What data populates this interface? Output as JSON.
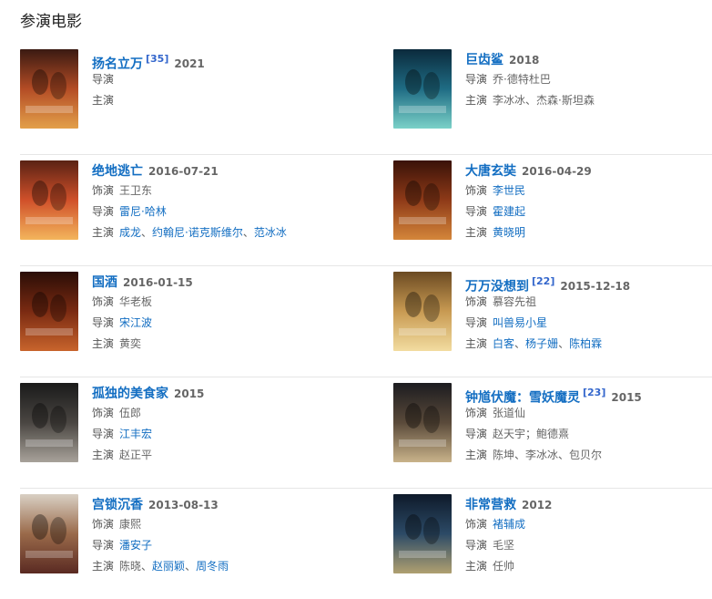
{
  "section_title": "参演电影",
  "movies": [
    {
      "title": "扬名立万",
      "ref": "[35]",
      "meta": "2021",
      "lines": [
        {
          "label": "导演",
          "parts": []
        },
        {
          "label": "主演",
          "parts": []
        }
      ],
      "poster_colors": [
        "#3a1a12",
        "#b44c25",
        "#e3a04a"
      ]
    },
    {
      "title": "巨齿鲨",
      "ref": "",
      "meta": "2018",
      "lines": [
        {
          "label": "导演",
          "parts": [
            {
              "t": "乔·德特杜巴",
              "link": false
            }
          ]
        },
        {
          "label": "主演",
          "parts": [
            {
              "t": "李冰冰、杰森·斯坦森",
              "link": false
            }
          ]
        }
      ],
      "poster_colors": [
        "#0b2a3c",
        "#1f6c84",
        "#7bd1c8"
      ]
    },
    {
      "title": "绝地逃亡",
      "ref": "",
      "meta": "2016-07-21",
      "lines": [
        {
          "label": "饰演",
          "parts": [
            {
              "t": "王卫东",
              "link": false
            }
          ]
        },
        {
          "label": "导演",
          "parts": [
            {
              "t": "雷尼·哈林",
              "link": true
            }
          ]
        },
        {
          "label": "主演",
          "parts": [
            {
              "t": "成龙",
              "link": true
            },
            {
              "t": "、",
              "link": false
            },
            {
              "t": "约翰尼·诺克斯维尔",
              "link": true
            },
            {
              "t": "、",
              "link": false
            },
            {
              "t": "范冰冰",
              "link": true
            }
          ]
        }
      ],
      "poster_colors": [
        "#5a2214",
        "#d0502a",
        "#f3b55c"
      ]
    },
    {
      "title": "大唐玄奘",
      "ref": "",
      "meta": "2016-04-29",
      "lines": [
        {
          "label": "饰演",
          "parts": [
            {
              "t": "李世民",
              "link": true
            }
          ]
        },
        {
          "label": "导演",
          "parts": [
            {
              "t": "霍建起",
              "link": true
            }
          ]
        },
        {
          "label": "主演",
          "parts": [
            {
              "t": "黄晓明",
              "link": true
            }
          ]
        }
      ],
      "poster_colors": [
        "#3a1208",
        "#8e3a18",
        "#d4863a"
      ]
    },
    {
      "title": "国酒",
      "ref": "",
      "meta": "2016-01-15",
      "lines": [
        {
          "label": "饰演",
          "parts": [
            {
              "t": "华老板",
              "link": false
            }
          ]
        },
        {
          "label": "导演",
          "parts": [
            {
              "t": "宋江波",
              "link": true
            }
          ]
        },
        {
          "label": "主演",
          "parts": [
            {
              "t": "黄奕",
              "link": false
            }
          ]
        }
      ],
      "poster_colors": [
        "#2a0d06",
        "#7a2a12",
        "#c8642c"
      ]
    },
    {
      "title": "万万没想到",
      "ref": "[22]",
      "meta": "2015-12-18",
      "lines": [
        {
          "label": "饰演",
          "parts": [
            {
              "t": "慕容先祖",
              "link": false
            }
          ]
        },
        {
          "label": "导演",
          "parts": [
            {
              "t": "叫兽易小星",
              "link": true
            }
          ]
        },
        {
          "label": "主演",
          "parts": [
            {
              "t": "白客",
              "link": true
            },
            {
              "t": "、",
              "link": false
            },
            {
              "t": "杨子姗",
              "link": true
            },
            {
              "t": "、",
              "link": false
            },
            {
              "t": "陈柏霖",
              "link": true
            }
          ]
        }
      ],
      "poster_colors": [
        "#6b4a22",
        "#c89a52",
        "#f2dca0"
      ]
    },
    {
      "title": "孤独的美食家",
      "ref": "",
      "meta": "2015",
      "lines": [
        {
          "label": "饰演",
          "parts": [
            {
              "t": "伍郎",
              "link": false
            }
          ]
        },
        {
          "label": "导演",
          "parts": [
            {
              "t": "江丰宏",
              "link": true
            }
          ]
        },
        {
          "label": "主演",
          "parts": [
            {
              "t": "赵正平",
              "link": false
            }
          ]
        }
      ],
      "poster_colors": [
        "#1a1a1a",
        "#4a4642",
        "#a8a29a"
      ]
    },
    {
      "title": "钟馗伏魔：雪妖魔灵",
      "ref": "[23]",
      "meta": "2015",
      "lines": [
        {
          "label": "饰演",
          "parts": [
            {
              "t": "张道仙",
              "link": false
            }
          ]
        },
        {
          "label": "导演",
          "parts": [
            {
              "t": "赵天宇；鲍德熹",
              "link": false
            }
          ]
        },
        {
          "label": "主演",
          "parts": [
            {
              "t": "陈坤、李冰冰、包贝尔",
              "link": false
            }
          ]
        }
      ],
      "poster_colors": [
        "#1c1c20",
        "#5a4a3a",
        "#c9b38a"
      ]
    },
    {
      "title": "宫锁沉香",
      "ref": "",
      "meta": "2013-08-13",
      "lines": [
        {
          "label": "饰演",
          "parts": [
            {
              "t": "康熙",
              "link": false
            }
          ]
        },
        {
          "label": "导演",
          "parts": [
            {
              "t": "潘安子",
              "link": true
            }
          ]
        },
        {
          "label": "主演",
          "parts": [
            {
              "t": "陈晓",
              "link": false
            },
            {
              "t": "、",
              "link": false
            },
            {
              "t": "赵丽颖",
              "link": true
            },
            {
              "t": "、",
              "link": false
            },
            {
              "t": "周冬雨",
              "link": true
            }
          ]
        }
      ],
      "poster_colors": [
        "#d9d0c4",
        "#9a6a4a",
        "#5a2a22"
      ]
    },
    {
      "title": "非常营救",
      "ref": "",
      "meta": "2012",
      "lines": [
        {
          "label": "饰演",
          "parts": [
            {
              "t": "褚辅成",
              "link": true
            }
          ]
        },
        {
          "label": "导演",
          "parts": [
            {
              "t": "毛坚",
              "link": false
            }
          ]
        },
        {
          "label": "主演",
          "parts": [
            {
              "t": "任帅",
              "link": false
            }
          ]
        }
      ],
      "poster_colors": [
        "#0e1a2a",
        "#2c4a66",
        "#b0a070"
      ]
    }
  ]
}
